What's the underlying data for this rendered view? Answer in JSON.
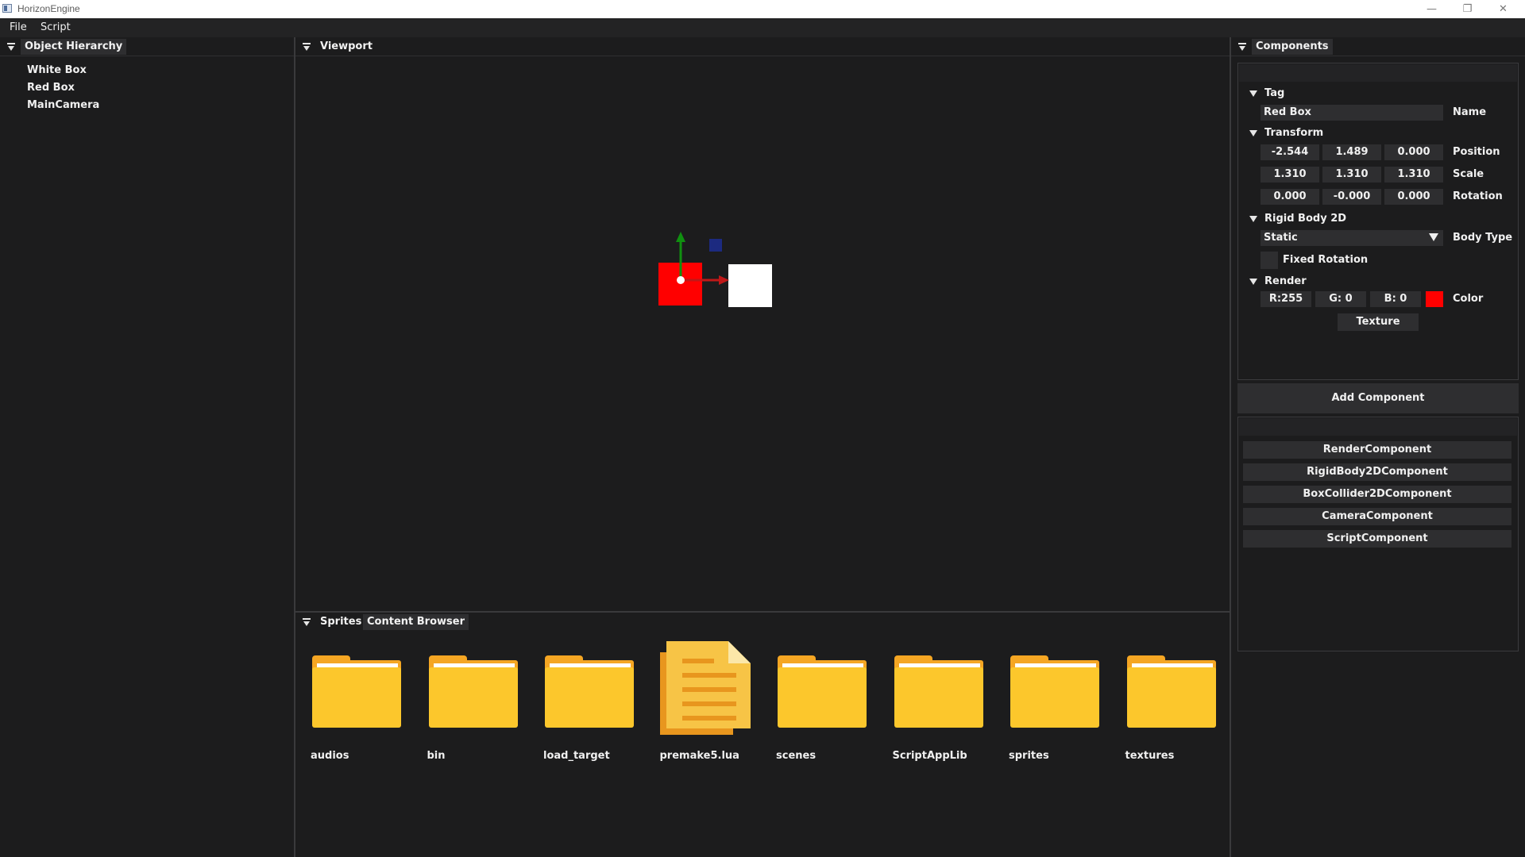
{
  "window": {
    "title": "HorizonEngine",
    "controls": {
      "minimize": "—",
      "restore": "❐",
      "close": "✕"
    }
  },
  "menubar": {
    "items": [
      "File",
      "Script"
    ]
  },
  "hierarchy": {
    "title": "Object Hierarchy",
    "items": [
      "White Box",
      "Red Box",
      "MainCamera"
    ]
  },
  "viewport": {
    "title": "Viewport",
    "colors": {
      "red_box": "#ff0000",
      "white_box": "#ffffff",
      "gizmo_x": "#c01818",
      "gizmo_y": "#109010",
      "gizmo_plane": "#1c2a80"
    }
  },
  "components": {
    "title": "Components",
    "tag": {
      "header": "Tag",
      "name_value": "Red Box",
      "name_label": "Name"
    },
    "transform": {
      "header": "Transform",
      "position": {
        "x": "-2.544",
        "y": "1.489",
        "z": "0.000",
        "label": "Position"
      },
      "scale": {
        "x": "1.310",
        "y": "1.310",
        "z": "1.310",
        "label": "Scale"
      },
      "rotation": {
        "x": "0.000",
        "y": "-0.000",
        "z": "0.000",
        "label": "Rotation"
      }
    },
    "rigid_body": {
      "header": "Rigid Body 2D",
      "body_type_value": "Static",
      "body_type_label": "Body Type",
      "fixed_rotation_label": "Fixed Rotation",
      "fixed_rotation_checked": false
    },
    "render": {
      "header": "Render",
      "r": "R:255",
      "g": "G:  0",
      "b": "B:  0",
      "color_swatch": "#ff0000",
      "color_label": "Color",
      "texture_button": "Texture"
    },
    "add_component_button": "Add Component",
    "component_list": [
      "RenderComponent",
      "RigidBody2DComponent",
      "BoxCollider2DComponent",
      "CameraComponent",
      "ScriptComponent"
    ]
  },
  "bottom_panel": {
    "tabs": [
      "Sprites",
      "Content Browser"
    ],
    "items": [
      {
        "name": "audios",
        "icon": "folder-icon"
      },
      {
        "name": "bin",
        "icon": "folder-icon"
      },
      {
        "name": "load_target",
        "icon": "folder-icon"
      },
      {
        "name": "premake5.lua",
        "icon": "file-icon"
      },
      {
        "name": "scenes",
        "icon": "folder-icon"
      },
      {
        "name": "ScriptAppLib",
        "icon": "folder-icon"
      },
      {
        "name": "sprites",
        "icon": "folder-icon"
      },
      {
        "name": "textures",
        "icon": "folder-icon"
      }
    ]
  }
}
